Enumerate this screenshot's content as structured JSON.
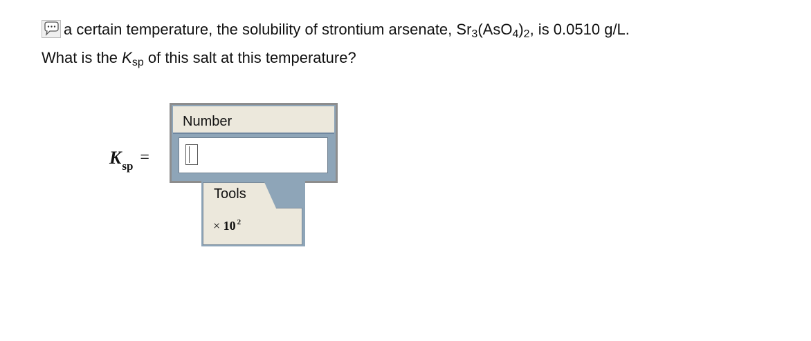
{
  "question": {
    "line1_prefix": "a certain temperature, the solubility of strontium arsenate, Sr",
    "sub1": "3",
    "mid1": "(AsO",
    "sub2": "4",
    "mid2": ")",
    "sub3": "2",
    "line1_suffix": ", is 0.0510 g/L.",
    "line2_prefix": "What is the ",
    "k": "K",
    "k_sub": "sp",
    "line2_suffix": " of this salt at this temperature?"
  },
  "answer": {
    "k": "K",
    "k_sub": "sp",
    "equals": "=",
    "widget_title": "Number",
    "value": ""
  },
  "tools": {
    "tab_label": "Tools",
    "times": "×",
    "ten": "10",
    "power": "2"
  },
  "icons": {
    "feedback": "speech-bubble-icon"
  },
  "colors": {
    "panel_blue": "#8ea5b8",
    "panel_beige": "#ece8dc"
  }
}
